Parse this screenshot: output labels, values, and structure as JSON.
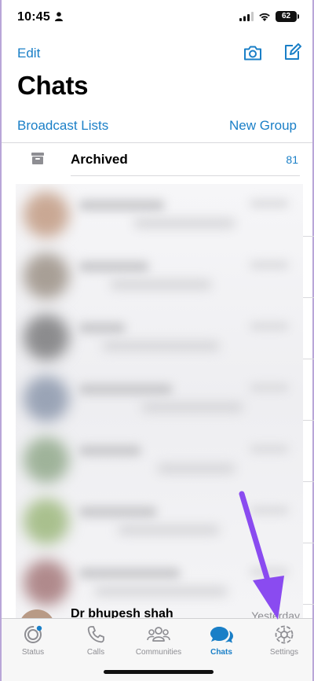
{
  "status_bar": {
    "time": "10:45",
    "battery": "62"
  },
  "header": {
    "edit_label": "Edit",
    "title": "Chats",
    "broadcast_label": "Broadcast Lists",
    "new_group_label": "New Group"
  },
  "archived": {
    "label": "Archived",
    "count": "81"
  },
  "visible_chat": {
    "name": "Dr bhupesh shah",
    "time": "Yesterday"
  },
  "tabs": [
    {
      "label": "Status",
      "icon": "status-icon"
    },
    {
      "label": "Calls",
      "icon": "phone-icon"
    },
    {
      "label": "Communities",
      "icon": "communities-icon"
    },
    {
      "label": "Chats",
      "icon": "chats-icon",
      "active": true
    },
    {
      "label": "Settings",
      "icon": "gear-icon"
    }
  ],
  "colors": {
    "accent": "#1a7fc7",
    "annotation_arrow": "#8a4bf0"
  }
}
